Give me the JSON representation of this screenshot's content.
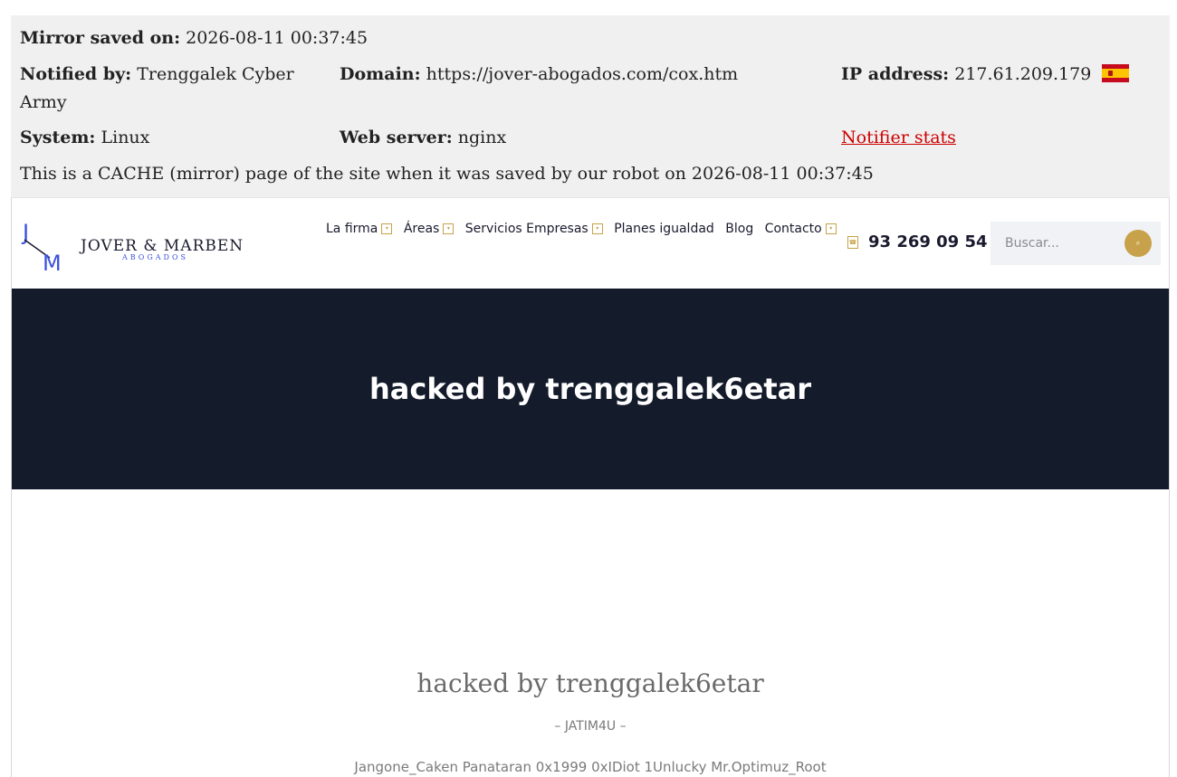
{
  "mirror": {
    "saved_label": "Mirror saved on:",
    "saved_value": "2026-08-11 00:37:45",
    "notified_label": "Notified by:",
    "notified_value_line1": "Trenggalek Cyber",
    "notified_value_line2": "Army",
    "domain_label": "Domain:",
    "domain_value": "https://jover-abogados.com/cox.htm",
    "ip_label": "IP address:",
    "ip_value": "217.61.209.179",
    "flag_icon": "spain-flag-icon",
    "system_label": "System:",
    "system_value": "Linux",
    "webserver_label": "Web server:",
    "webserver_value": "nginx",
    "notifier_stats_link": "Notifier stats",
    "cache_note": "This is a CACHE (mirror) page of the site when it was saved by our robot on 2026-08-11 00:37:45",
    "link_color": "#cc0000"
  },
  "site": {
    "logo": {
      "initial_j": "J",
      "initial_m": "M",
      "name": "JOVER & MARBEN",
      "tagline": "ABOGADOS"
    },
    "nav": [
      {
        "label": "La firma",
        "has_dropdown": true
      },
      {
        "label": "Áreas",
        "has_dropdown": true
      },
      {
        "label": "Servicios Empresas",
        "has_dropdown": true
      },
      {
        "label": "Planes igualdad",
        "has_dropdown": false
      },
      {
        "label": "Blog",
        "has_dropdown": false
      },
      {
        "label": "Contacto",
        "has_dropdown": true
      }
    ],
    "phone": "93 269 09 54",
    "search_placeholder": "Buscar...",
    "accent_color": "#c8a24a",
    "hero_bg": "#141b2b",
    "hero_title": "hacked by trenggalek6etar",
    "content_title": "hacked by trenggalek6etar",
    "content_sub": "– JATIM4U –",
    "content_names": "Jangone_Caken    Panataran    0x1999    0xIDiot    1Unlucky    Mr.Optimuz_Root"
  }
}
